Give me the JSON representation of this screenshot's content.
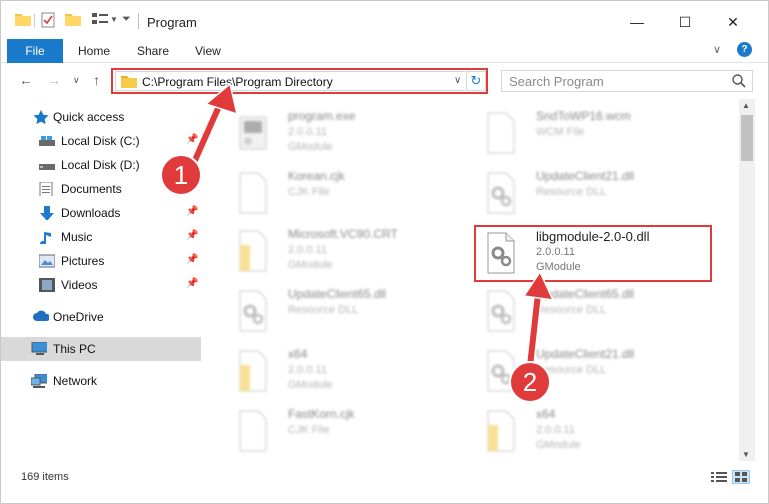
{
  "window": {
    "title": "Program"
  },
  "ribbon": {
    "tabs": [
      "File",
      "Home",
      "Share",
      "View"
    ]
  },
  "address": {
    "path": "C:\\Program Files\\Program Directory"
  },
  "search": {
    "placeholder": "Search Program"
  },
  "sidebar": {
    "items": [
      {
        "label": "Quick access",
        "icon": "star-icon"
      },
      {
        "label": "Local Disk (C:)",
        "icon": "drive-icon"
      },
      {
        "label": "Local Disk (D:)",
        "icon": "drive-icon"
      },
      {
        "label": "Documents",
        "icon": "documents-icon"
      },
      {
        "label": "Downloads",
        "icon": "downloads-icon"
      },
      {
        "label": "Music",
        "icon": "music-icon"
      },
      {
        "label": "Pictures",
        "icon": "pictures-icon"
      },
      {
        "label": "Videos",
        "icon": "videos-icon"
      },
      {
        "label": "OneDrive",
        "icon": "onedrive-icon"
      },
      {
        "label": "This PC",
        "icon": "computer-icon"
      },
      {
        "label": "Network",
        "icon": "network-icon"
      }
    ]
  },
  "files": [
    {
      "name": "program.exe",
      "line1": "2.0.0.11",
      "line2": "GModule",
      "icon": "exe-icon"
    },
    {
      "name": "SndToWP16.wcm",
      "line1": "WCM File",
      "line2": "",
      "icon": "blank-file-icon"
    },
    {
      "name": "Korean.cjk",
      "line1": "CJK File",
      "line2": "",
      "icon": "blank-file-icon"
    },
    {
      "name": "UpdateClient21.dll",
      "line1": "Resource DLL",
      "line2": "",
      "icon": "dll-icon"
    },
    {
      "name": "Microsoft.VC90.CRT",
      "line1": "2.0.0.11",
      "line2": "GModule",
      "icon": "folder-file-icon"
    },
    {
      "name": "libgmodule-2.0-0.dll",
      "line1": "2.0.0.11",
      "line2": "GModule",
      "icon": "dll-icon"
    },
    {
      "name": "UpdateClient65.dll",
      "line1": "Resource DLL",
      "line2": "",
      "icon": "dll-icon"
    },
    {
      "name": "UpdateClient65.dll",
      "line1": "Resource DLL",
      "line2": "",
      "icon": "dll-icon"
    },
    {
      "name": "x64",
      "line1": "2.0.0.11",
      "line2": "GModule",
      "icon": "folder-file-icon"
    },
    {
      "name": "UpdateClient21.dll",
      "line1": "Resource DLL",
      "line2": "",
      "icon": "dll-icon"
    },
    {
      "name": "FastKorn.cjk",
      "line1": "CJK File",
      "line2": "",
      "icon": "blank-file-icon"
    },
    {
      "name": "x64",
      "line1": "2.0.0.11",
      "line2": "GModule",
      "icon": "folder-file-icon"
    }
  ],
  "status": {
    "item_count": "169 items"
  },
  "annotations": {
    "step1": "1",
    "step2": "2"
  },
  "colors": {
    "accent": "#1979ca",
    "highlight": "#e03a3a",
    "folder": "#f4c542"
  }
}
